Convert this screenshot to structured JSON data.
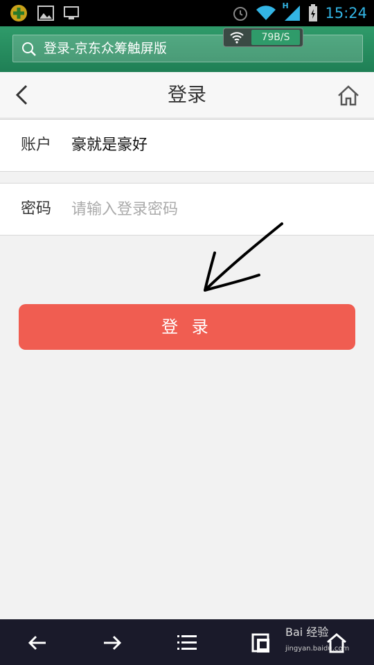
{
  "status_bar": {
    "time": "15:24",
    "network_label": "H",
    "icons": [
      "app-icon",
      "image-icon",
      "monitor-icon",
      "alarm-icon",
      "wifi-icon",
      "signal-icon",
      "battery-icon"
    ]
  },
  "browser": {
    "url_text": "登录-京东众筹触屏版",
    "speed": "79B/S"
  },
  "header": {
    "title": "登录"
  },
  "form": {
    "account_label": "账户",
    "account_value": "豪就是豪好",
    "password_label": "密码",
    "password_placeholder": "请输入登录密码"
  },
  "login_button": "登 录",
  "bottom_nav": {
    "items": [
      "back-icon",
      "forward-icon",
      "menu-icon",
      "tabs-icon",
      "home-icon"
    ]
  },
  "watermark": {
    "brand": "Bai 经验",
    "url": "jingyan.baidu.com"
  },
  "colors": {
    "accent": "#f05d51",
    "address_bar": "#2f9b6a",
    "status_blue": "#33b5e5"
  }
}
